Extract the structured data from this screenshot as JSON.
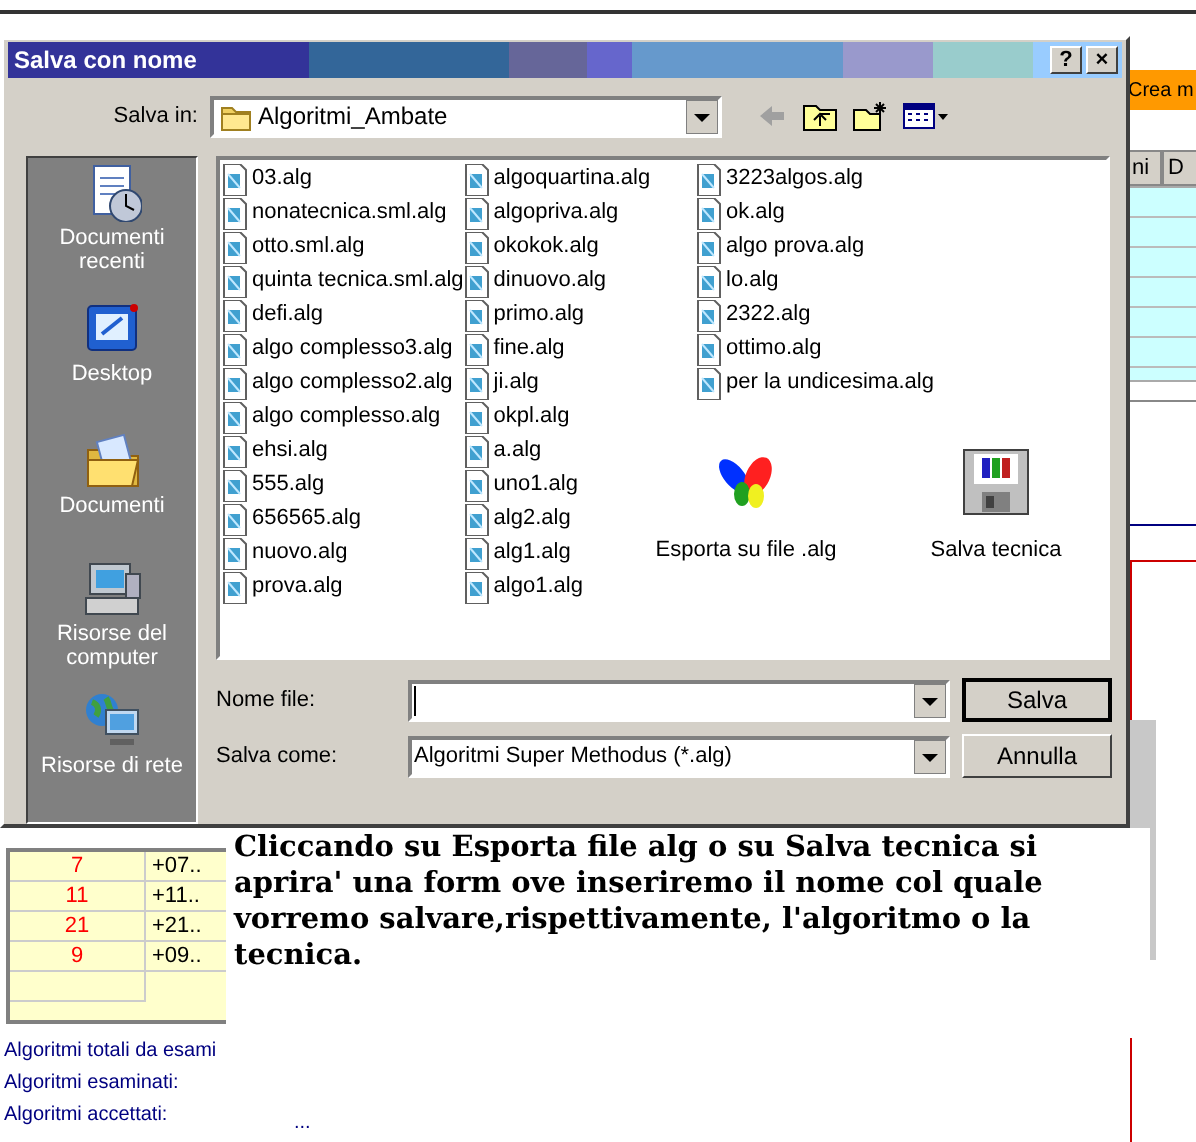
{
  "background_app": {
    "create_button": "Crea m",
    "column_headers": [
      "ni",
      "D"
    ],
    "table_rows": [
      {
        "column_1": "7",
        "column_2": "+07.."
      },
      {
        "column_1": "11",
        "column_2": "+11.."
      },
      {
        "column_1": "21",
        "column_2": "+21.."
      },
      {
        "column_1": "9",
        "column_2": "+09.."
      }
    ],
    "stats": [
      {
        "label": "Algoritmi totali da esami"
      },
      {
        "label": "Algoritmi esaminati:"
      },
      {
        "label": "Algoritmi accettati:",
        "value": "..."
      }
    ]
  },
  "dialog": {
    "title": "Salva con nome",
    "title_buttons": [
      "?",
      "×"
    ],
    "save_in_label": "Salva in:",
    "save_in_value": "Algoritmi_Ambate",
    "places": [
      {
        "label": "Documenti recenti",
        "kind": "recent"
      },
      {
        "label": "Desktop",
        "kind": "desktop"
      },
      {
        "label": "Documenti",
        "kind": "documents"
      },
      {
        "label": "Risorse del computer",
        "kind": "computer"
      },
      {
        "label": "Risorse di rete",
        "kind": "network"
      }
    ],
    "files": [
      "03.alg",
      "nonatecnica.sml.alg",
      "otto.sml.alg",
      "quinta tecnica.sml.alg",
      "defi.alg",
      "algo complesso3.alg",
      "algo complesso2.alg",
      "algo complesso.alg",
      "ehsi.alg",
      "555.alg",
      "656565.alg",
      "nuovo.alg",
      "prova.alg",
      "algoquartina.alg",
      "algopriva.alg",
      "okokok.alg",
      "dinuovo.alg",
      "primo.alg",
      "fine.alg",
      "ji.alg",
      "okpl.alg",
      "a.alg",
      "uno1.alg",
      "alg2.alg",
      "alg1.alg",
      "algo1.alg",
      "3223algos.alg",
      "ok.alg",
      "algo prova.alg",
      "lo.alg",
      "2322.alg",
      "ottimo.alg",
      "per la undicesima.alg"
    ],
    "shortcuts": [
      {
        "label": "Esporta su file .alg",
        "kind": "butterfly"
      },
      {
        "label": "Salva tecnica",
        "kind": "floppy"
      }
    ],
    "file_name_label": "Nome file:",
    "save_as_label": "Salva come:",
    "save_as_value": "Algoritmi Super Methodus (*.alg)",
    "buttons": [
      {
        "label": "Salva",
        "default": true
      },
      {
        "label": "Annulla",
        "default": false
      }
    ]
  },
  "note": "Cliccando su Esporta file alg o su Salva tecnica si aprira' una form ove inseriremo il nome col quale vorremo salvare,rispettivamente, l'algoritmo o la tecnica."
}
